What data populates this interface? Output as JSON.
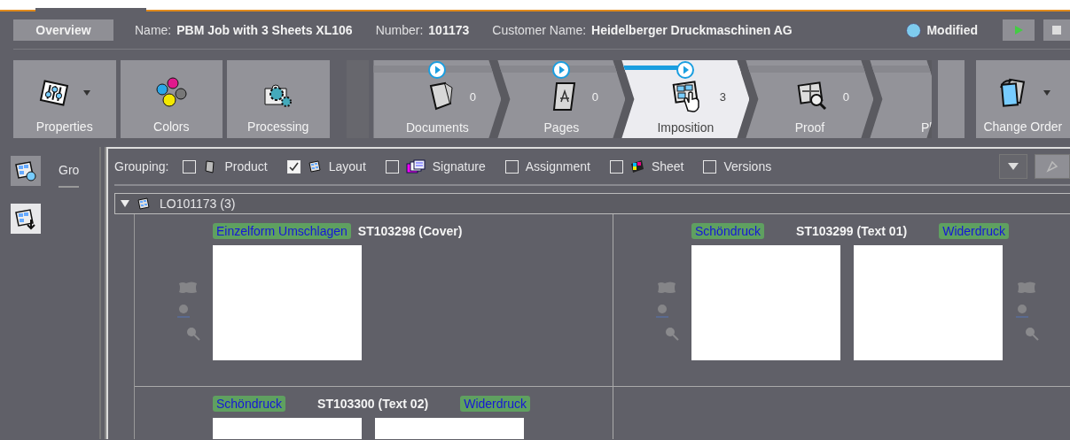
{
  "header": {
    "overview_button": "Overview",
    "fields": [
      {
        "label": "Name:",
        "value": "PBM Job with 3 Sheets XL106"
      },
      {
        "label": "Number:",
        "value": "101173"
      },
      {
        "label": "Customer Name:",
        "value": "Heidelberger Druckmaschinen AG"
      }
    ],
    "status": {
      "label": "Modified",
      "color": "#7ecbee"
    }
  },
  "tools": [
    {
      "label": "Properties",
      "kind": "properties",
      "menu": true
    },
    {
      "label": "Colors",
      "kind": "colors",
      "menu": false
    },
    {
      "label": "Processing",
      "kind": "processing",
      "menu": false
    }
  ],
  "workflow": [
    {
      "label": "Documents",
      "kind": "documents",
      "count": "0",
      "selected": false,
      "playable": true
    },
    {
      "label": "Pages",
      "kind": "pages",
      "count": "0",
      "selected": false,
      "playable": true
    },
    {
      "label": "Imposition",
      "kind": "imposition",
      "count": "3",
      "selected": true,
      "playable": true,
      "level": 0.55
    },
    {
      "label": "Proof",
      "kind": "proof",
      "count": "0",
      "selected": false,
      "playable": false
    },
    {
      "label": "Pl",
      "selected": false,
      "playable": false
    }
  ],
  "change_order": {
    "label": "Change Order",
    "menu": true
  },
  "sidebar": {
    "tab_label": "Gro"
  },
  "grouping": {
    "label": "Grouping:",
    "options": [
      {
        "label": "Product",
        "kind": "product",
        "checked": false
      },
      {
        "label": "Layout",
        "kind": "layout",
        "checked": true
      },
      {
        "label": "Signature",
        "kind": "signature",
        "checked": false
      },
      {
        "label": "Assignment",
        "checked": false
      },
      {
        "label": "Sheet",
        "kind": "sheet",
        "checked": false
      },
      {
        "label": "Versions",
        "checked": false
      }
    ]
  },
  "tree": {
    "label": "LO101173 (3)",
    "expanded": true,
    "sheets": [
      {
        "name": "ST103298 (Cover)",
        "sides": [
          "Einzelform Umschlagen"
        ]
      },
      {
        "name": "ST103299 (Text 01)",
        "sides": [
          "Schöndruck",
          "Widerdruck"
        ]
      },
      {
        "name": "ST103300 (Text 02)",
        "sides": [
          "Schöndruck",
          "Widerdruck"
        ]
      }
    ]
  }
}
